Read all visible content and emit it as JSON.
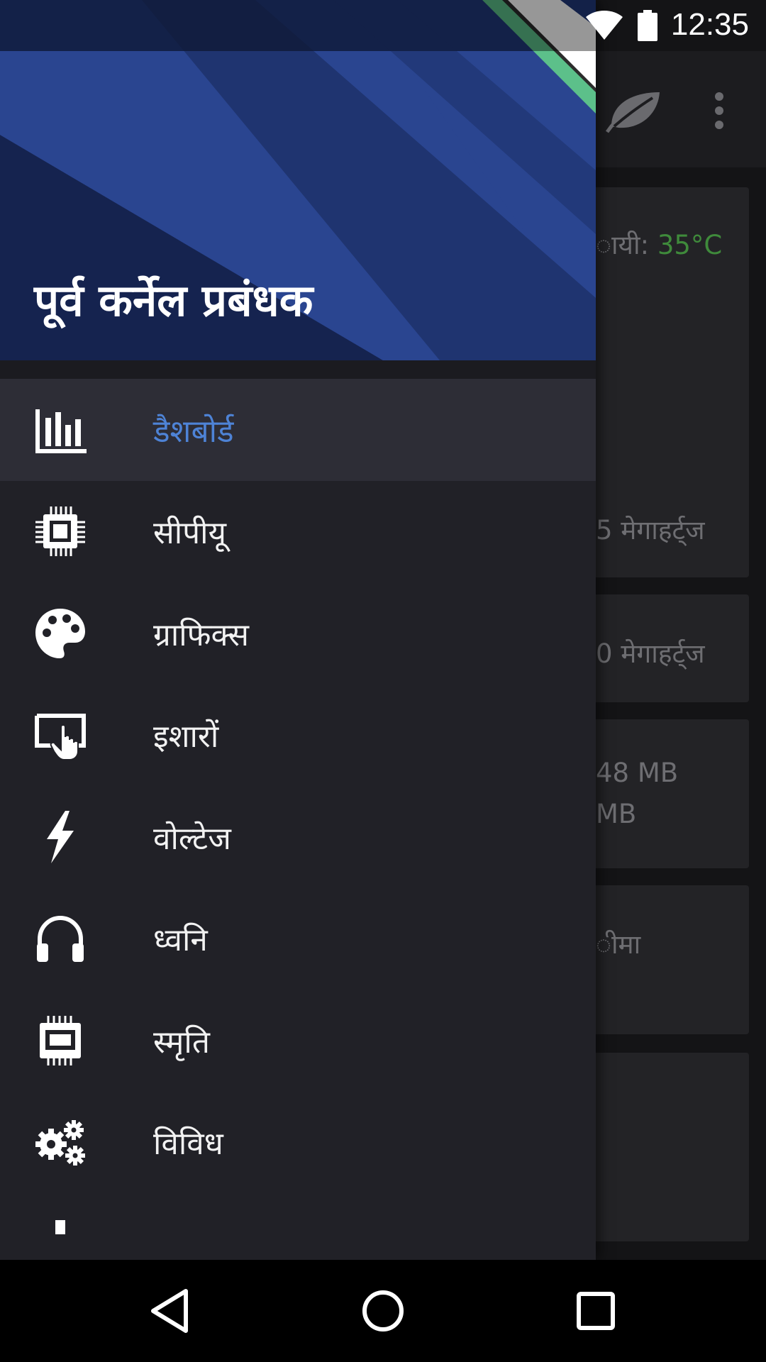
{
  "status_bar": {
    "time": "12:35",
    "icons": [
      "wifi-icon",
      "battery-icon"
    ]
  },
  "background": {
    "toolbar_icons": [
      "leaf-icon",
      "overflow-menu-icon"
    ],
    "temperature_label": "ायी:",
    "temperature_value": "35°C",
    "temperature_color": "#3f8a3b",
    "cards": [
      {
        "text": "5 मेगाहर्ट्ज"
      },
      {
        "text": "0 मेगाहर्ट्ज"
      },
      {
        "text_line1": "48 MB",
        "text_line2": "MB"
      },
      {
        "text": "ीमा"
      },
      {
        "text": ""
      }
    ]
  },
  "drawer": {
    "header_title": "पूर्व कर्नेल प्रबंधक",
    "accent_color": "#4e83d6",
    "items": [
      {
        "label": "डैशबोर्ड",
        "icon": "dashboard-chart-icon",
        "active": true
      },
      {
        "label": "सीपीयू",
        "icon": "cpu-chip-icon",
        "active": false
      },
      {
        "label": "ग्राफिक्स",
        "icon": "palette-icon",
        "active": false
      },
      {
        "label": "इशारों",
        "icon": "gesture-touch-icon",
        "active": false
      },
      {
        "label": "वोल्टेज",
        "icon": "lightning-bolt-icon",
        "active": false
      },
      {
        "label": "ध्वनि",
        "icon": "headphones-icon",
        "active": false
      },
      {
        "label": "स्मृति",
        "icon": "memory-chip-icon",
        "active": false
      },
      {
        "label": "विविध",
        "icon": "gears-icon",
        "active": false
      }
    ]
  },
  "nav_bar": {
    "buttons": [
      "back-icon",
      "home-icon",
      "recents-icon"
    ]
  }
}
